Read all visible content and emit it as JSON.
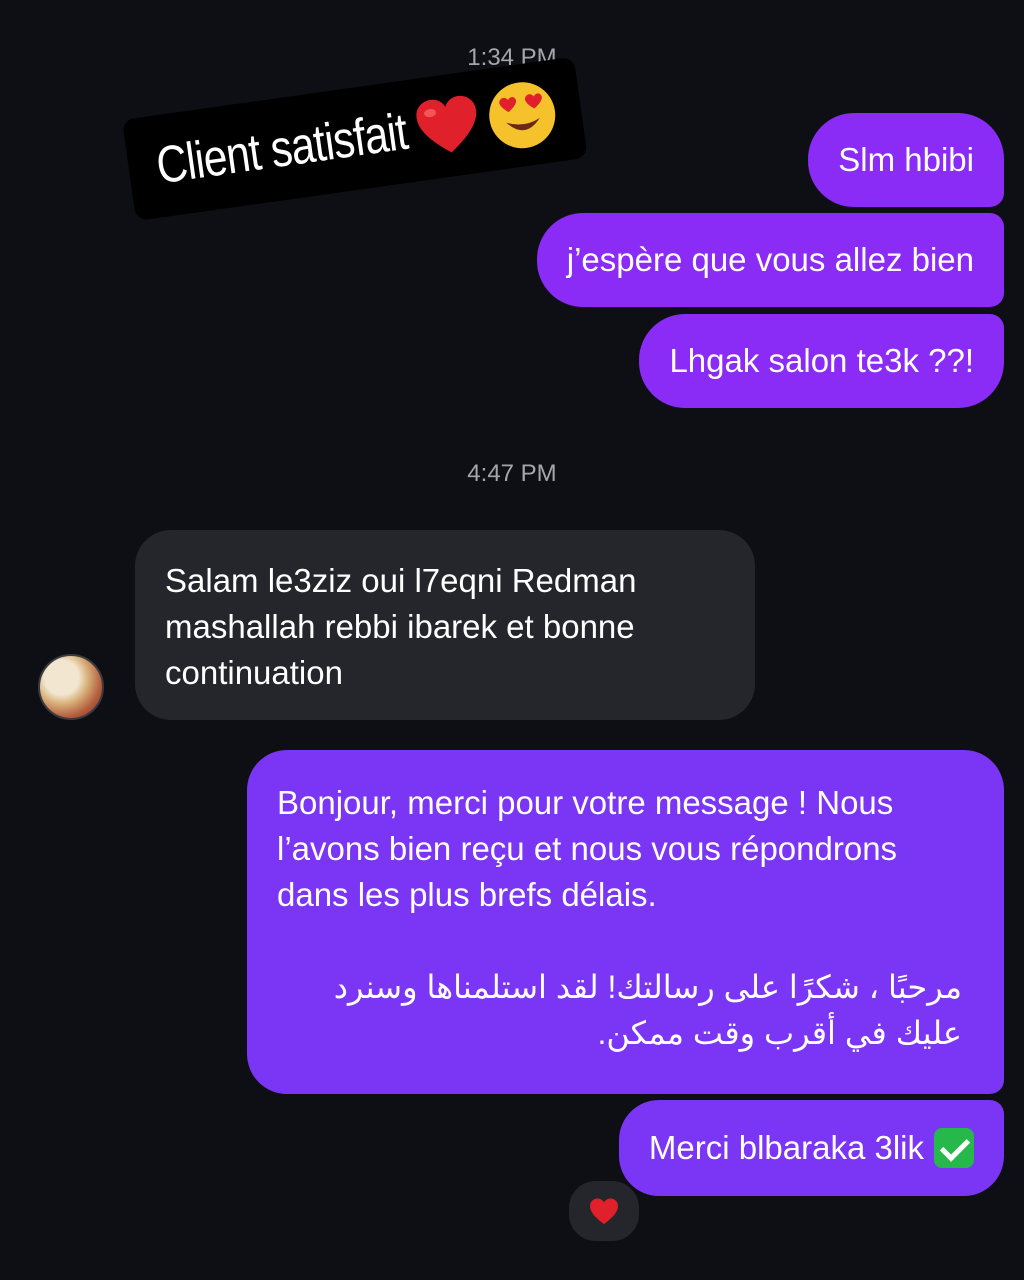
{
  "thread": {
    "timestamp_1": "1:34 PM",
    "timestamp_2": "4:47 PM"
  },
  "sticker": {
    "text": "Client satisfait",
    "emojis": [
      "heart-icon",
      "heart-eyes-icon"
    ]
  },
  "messages": [
    {
      "direction": "outgoing",
      "text": "Slm hbibi"
    },
    {
      "direction": "outgoing",
      "text": "j’espère que vous allez bien"
    },
    {
      "direction": "outgoing",
      "text": "Lhgak salon te3k ??!"
    },
    {
      "direction": "incoming",
      "text": "Salam le3ziz oui l7eqni  Redman mashallah rebbi ibarek et bonne continuation"
    },
    {
      "direction": "outgoing",
      "text_fr": "Bonjour, merci pour votre message ! Nous l’avons bien reçu et nous vous répondrons dans les plus brefs délais.",
      "text_ar": "مرحبًا ، شكرًا على رسالتك! لقد استلمناها وسنرد عليك في أقرب وقت ممكن."
    },
    {
      "direction": "outgoing",
      "text": "Merci blbaraka 3lik",
      "emoji": "check-mark-icon"
    }
  ],
  "reaction": {
    "emoji": "heart-icon"
  },
  "colors": {
    "background": "#0e0f14",
    "outgoing_bubble": "#8a2cf6",
    "incoming_bubble": "#25262c",
    "timestamp": "#a3a6ad"
  }
}
